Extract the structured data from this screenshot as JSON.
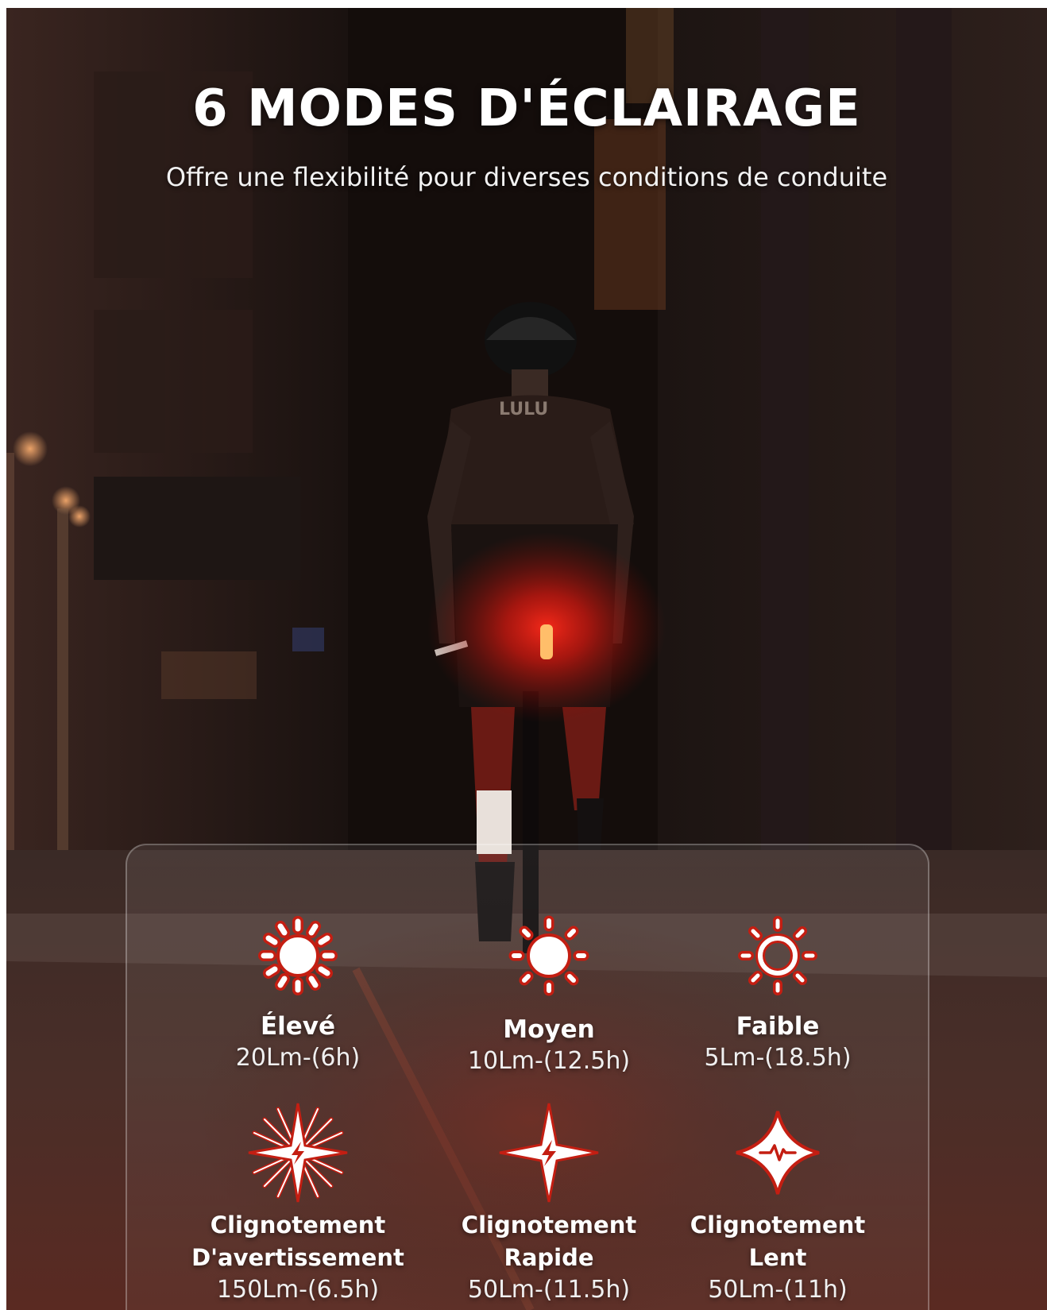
{
  "headline": "6 MODES D'ÉCLAIRAGE",
  "subheadline": "Offre une flexibilité pour diverses conditions de conduite",
  "jersey_text": "LULU",
  "modes": [
    {
      "icon": "sun-filled-icon",
      "title": "Élevé",
      "spec": "20Lm-(6h)"
    },
    {
      "icon": "sun-medium-icon",
      "title": "Moyen",
      "spec": "10Lm-(12.5h)"
    },
    {
      "icon": "sun-outline-icon",
      "title": "Faible",
      "spec": "5Lm-(18.5h)"
    },
    {
      "icon": "warning-flash-icon",
      "title_line1": "Clignotement",
      "title_line2": "D'avertissement",
      "spec": "150Lm-(6.5h)"
    },
    {
      "icon": "fast-flash-icon",
      "title_line1": "Clignotement",
      "title_line2": "Rapide",
      "spec": "50Lm-(11.5h)"
    },
    {
      "icon": "slow-flash-icon",
      "title_line1": "Clignotement",
      "title_line2": "Lent",
      "spec": "50Lm-(11h)"
    }
  ],
  "colors": {
    "accent_red": "#ff2a1a",
    "icon_outline": "#c41e12",
    "text": "#ffffff"
  }
}
